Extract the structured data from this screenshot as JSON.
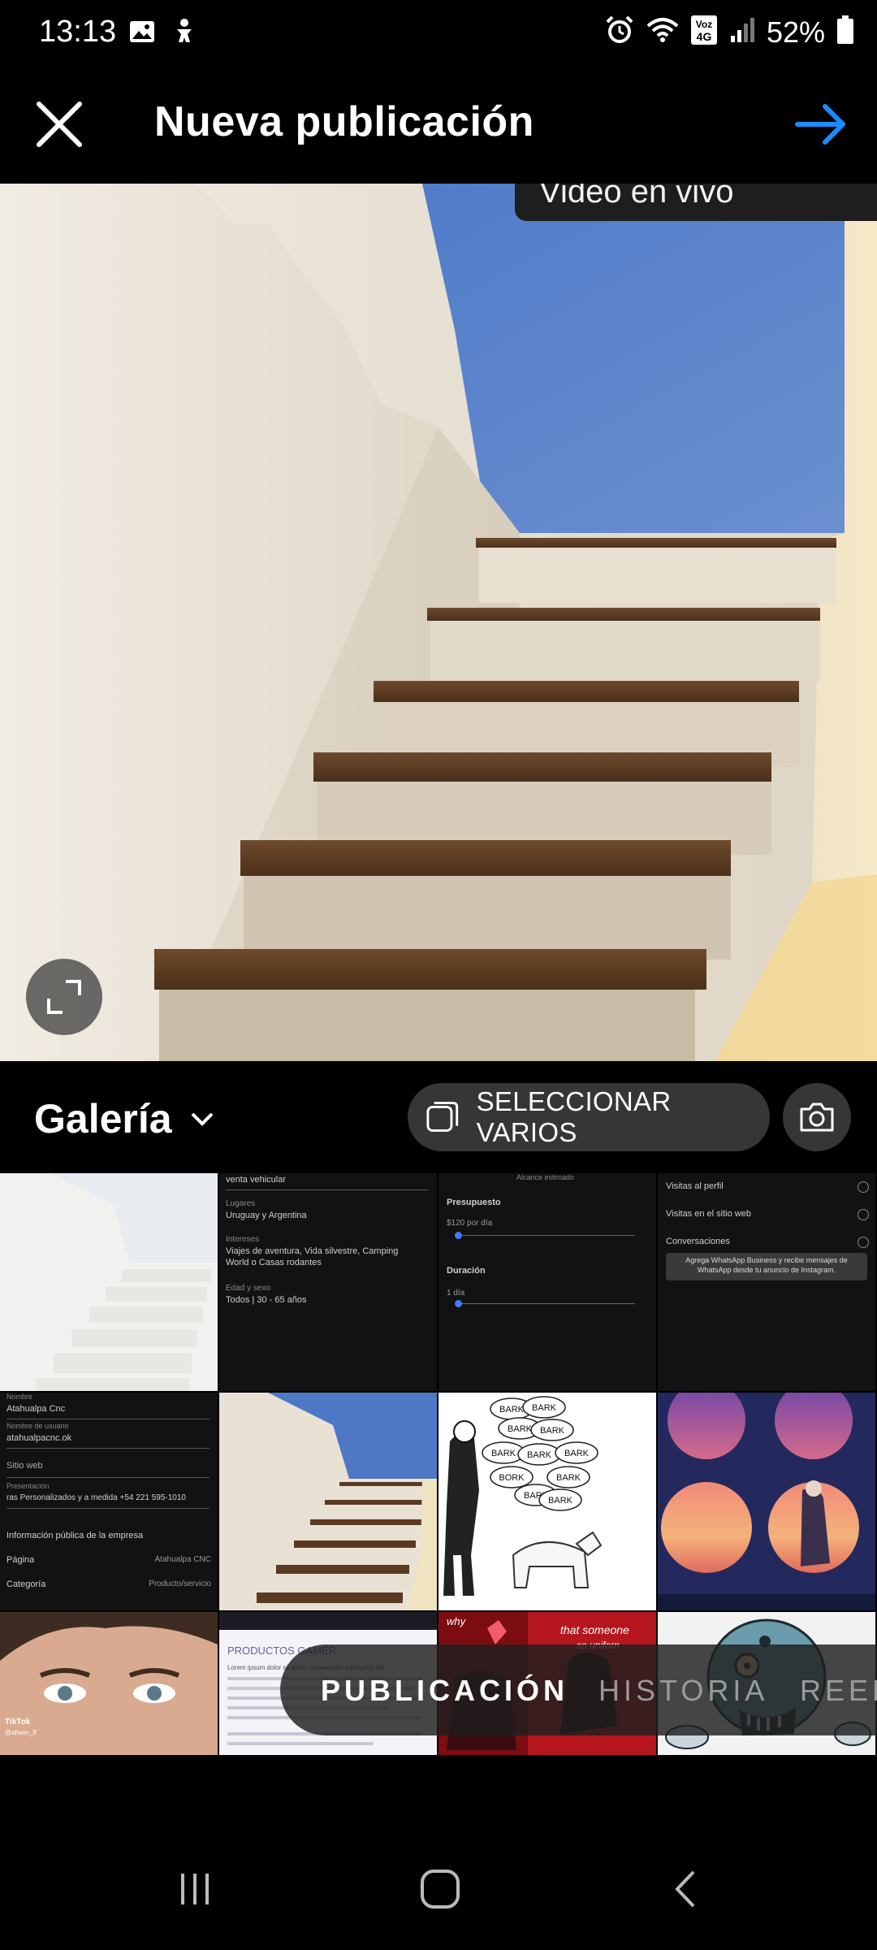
{
  "status_bar": {
    "time": "13:13",
    "battery": "52%",
    "network_label": "Voz 4G",
    "icons": [
      "gallery-icon",
      "accessibility-icon",
      "alarm-icon",
      "wifi-icon",
      "volte-4g-icon",
      "signal-icon",
      "battery-icon"
    ]
  },
  "header": {
    "title": "Nueva publicación",
    "close_icon": "close-icon",
    "next_icon": "arrow-right-icon",
    "accent_color": "#1a8cff"
  },
  "preview": {
    "tooltip_text": "Video en vivo",
    "expand_icon": "expand-icon"
  },
  "gallery": {
    "title": "Galería",
    "select_multiple_label": "SELECCIONAR VARIOS",
    "camera_icon": "camera-icon"
  },
  "thumbnails": {
    "t2": {
      "line0": "venta vehicular",
      "h1": "Lugares",
      "v1": "Uruguay y Argentina",
      "h2": "Intereses",
      "v2a": "Viajes de aventura, Vida silvestre, Camping",
      "v2b": "World o Casas rodantes",
      "h3": "Edad y sexo",
      "v3": "Todos | 30 - 65 años"
    },
    "t3": {
      "head": "Alcance estimado",
      "budget": "Presupuesto",
      "budget_val": "$120 por día",
      "duration": "Duración",
      "duration_val": "1 día"
    },
    "t4": {
      "o1": "Visitas al perfil",
      "o2": "Visitas en el sitio web",
      "o3": "Conversaciones",
      "note": "Agrega WhatsApp Business y recibe mensajes de WhatsApp desde tu anuncio de Instagram."
    },
    "t5": {
      "l1": "Nombre",
      "v1": "Atahualpa Cnc",
      "l2": "Nombre de usuario",
      "v2": "atahualpacnc.ok",
      "l3": "Sitio web",
      "l4": "Presentación",
      "v4": "ras Personalizados y a medida +54 221 595-1010",
      "h5": "Información pública de la empresa",
      "l6": "Página",
      "v6": "Atahualpa CNC",
      "l7": "Categoría",
      "v7": "Producto/servicio"
    },
    "t7": {
      "bubbles": [
        "BARK",
        "BARK",
        "BARK",
        "BARK",
        "BARK",
        "BARK",
        "BARK",
        "BARK",
        "BORK",
        "BARK",
        "BARK"
      ]
    },
    "t9": {
      "badge": "TikTok",
      "user": "@ahwer_ff"
    },
    "t10": {
      "title": "PRODUCTOS GAMER",
      "body": "Lorem ipsum dolor sit amet, consectetur adipiscing elit."
    },
    "t11": {
      "text1": "why",
      "text2": "that someone",
      "text3": "so uniforn"
    }
  },
  "mode_tabs": {
    "active": "PUBLICACIÓN",
    "tab2": "HISTORIA",
    "tab3": "REEL"
  },
  "nav_bar": {
    "icons": [
      "recent-apps-icon",
      "home-icon",
      "back-icon"
    ]
  }
}
